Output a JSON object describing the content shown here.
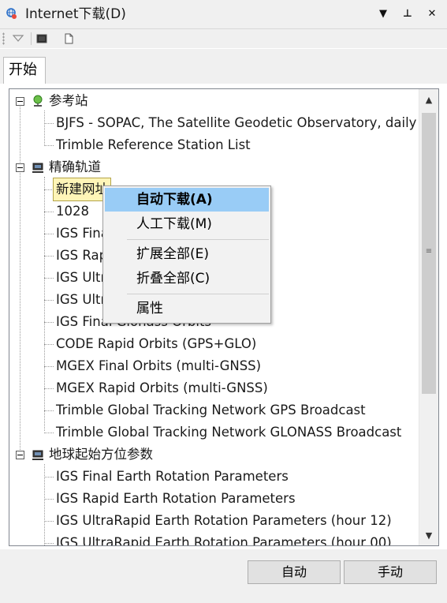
{
  "window": {
    "title": "Internet下载(D)",
    "buttons": {
      "dropdown": "▼",
      "pin": "⊥",
      "close": "✕"
    }
  },
  "toolbar": {
    "icons": [
      "filter-icon",
      "console-icon",
      "new-file-icon"
    ]
  },
  "tabs": [
    {
      "label": "开始"
    }
  ],
  "tree": {
    "groups": [
      {
        "label": "参考站",
        "icon": "globe-station-icon",
        "items": [
          "BJFS - SOPAC, The Satellite Geodetic Observatory, daily",
          "Trimble Reference Station List"
        ]
      },
      {
        "label": "精确轨道",
        "icon": "computer-icon",
        "items": [
          "新建网址",
          "1028",
          "IGS Final",
          "IGS Rap",
          "IGS Ultr",
          "IGS Ultr",
          "IGS Final Glonass Orbits",
          "CODE Rapid Orbits (GPS+GLO)",
          "MGEX Final Orbits (multi-GNSS)",
          "MGEX Rapid Orbits (multi-GNSS)",
          "Trimble Global Tracking Network GPS Broadcast",
          "Trimble Global Tracking Network GLONASS Broadcast"
        ]
      },
      {
        "label": "地球起始方位参数",
        "icon": "computer-icon",
        "items": [
          "IGS Final Earth Rotation Parameters",
          "IGS Rapid Earth Rotation Parameters",
          "IGS UltraRapid Earth Rotation Parameters (hour 12)",
          "IGS UltraRapid Earth Rotation Parameters (hour 00)"
        ]
      }
    ]
  },
  "context_menu": {
    "items": [
      {
        "label": "自动下载(A)",
        "highlighted": true
      },
      {
        "label": "人工下载(M)"
      },
      {
        "label": "扩展全部(E)"
      },
      {
        "label": "折叠全部(C)"
      },
      {
        "label": "属性"
      }
    ]
  },
  "buttons": {
    "auto": "自动",
    "manual": "手动"
  },
  "scrollbar": {
    "up": "▲",
    "down": "▼",
    "grip": "≡"
  },
  "colors": {
    "menu_highlight": "#99ccf6",
    "selection": "#fff5b8"
  }
}
